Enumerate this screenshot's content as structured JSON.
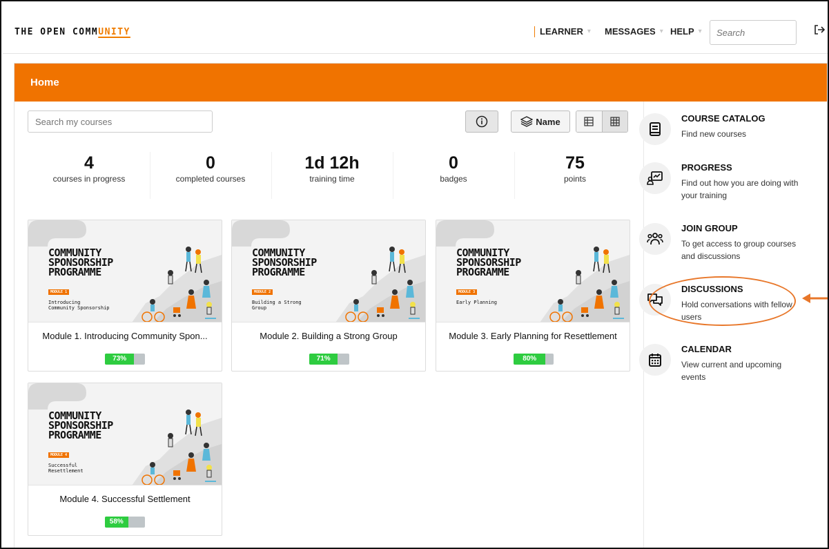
{
  "header": {
    "logo_prefix": "THE OPEN COMM",
    "logo_accent": "UNITY",
    "nav": [
      {
        "label": "LEARNER"
      },
      {
        "label": "MESSAGES"
      },
      {
        "label": "HELP"
      }
    ],
    "search_placeholder": "Search",
    "logout_icon": "logout-icon"
  },
  "main": {
    "title": "Home",
    "search_placeholder": "Search my courses",
    "sort_label": "Name",
    "stats": [
      {
        "value": "4",
        "label": "courses in progress"
      },
      {
        "value": "0",
        "label": "completed courses"
      },
      {
        "value": "1d 12h",
        "label": "training time"
      },
      {
        "value": "0",
        "label": "badges"
      },
      {
        "value": "75",
        "label": "points"
      }
    ],
    "courses": [
      {
        "thumb_title": "COMMUNITY\nSPONSORSHIP\nPROGRAMME",
        "thumb_module": "MODULE 1",
        "thumb_subtitle": "Introducing\nCommunity Sponsorship",
        "title": "Module 1. Introducing Community Spon...",
        "progress": 0.73,
        "progress_label": "73%"
      },
      {
        "thumb_title": "COMMUNITY\nSPONSORSHIP\nPROGRAMME",
        "thumb_module": "MODULE 2",
        "thumb_subtitle": "Building a Strong\nGroup",
        "title": "Module 2. Building a Strong Group",
        "progress": 0.71,
        "progress_label": "71%"
      },
      {
        "thumb_title": "COMMUNITY\nSPONSORSHIP\nPROGRAMME",
        "thumb_module": "MODULE 3",
        "thumb_subtitle": "Early Planning",
        "title": "Module 3. Early Planning for Resettlement",
        "progress": 0.8,
        "progress_label": "80%"
      },
      {
        "thumb_title": "COMMUNITY\nSPONSORSHIP\nPROGRAMME",
        "thumb_module": "MODULE 4",
        "thumb_subtitle": "Successful\nResettlement",
        "title": "Module 4. Successful Settlement",
        "progress": 0.58,
        "progress_label": "58%"
      }
    ]
  },
  "sidebar": {
    "items": [
      {
        "title": "COURSE CATALOG",
        "description": "Find new courses",
        "icon": "book-icon"
      },
      {
        "title": "PROGRESS",
        "description": "Find out how you are doing with your training",
        "icon": "progress-icon"
      },
      {
        "title": "JOIN GROUP",
        "description": "To get access to group courses and discussions",
        "icon": "group-icon"
      },
      {
        "title": "DISCUSSIONS",
        "description": "Hold conversations with fellow users",
        "icon": "chat-icon"
      },
      {
        "title": "CALENDAR",
        "description": "View current and upcoming events",
        "icon": "calendar-icon"
      }
    ]
  },
  "colors": {
    "accent": "#f07300",
    "progress_fill": "#2ecc40",
    "progress_track": "#bfc5c8"
  }
}
